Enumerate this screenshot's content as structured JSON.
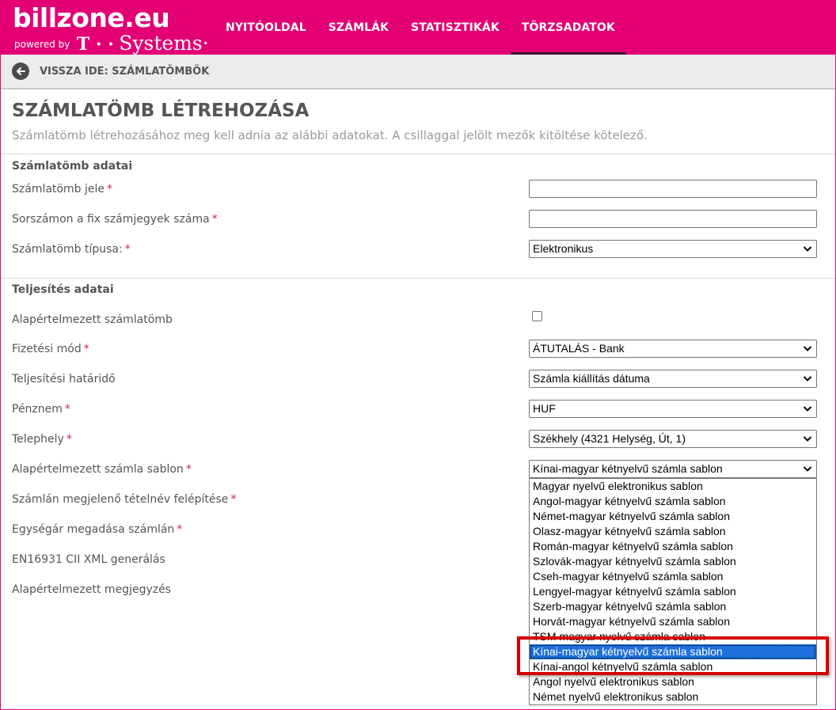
{
  "header": {
    "logo_main": "billzone.eu",
    "logo_powered": "powered by",
    "logo_tmark": "T · ·",
    "logo_systems": "Systems·",
    "nav": [
      {
        "label": "NYITÓOLDAL",
        "active": false
      },
      {
        "label": "SZÁMLÁK",
        "active": false
      },
      {
        "label": "STATISZTIKÁK",
        "active": false
      },
      {
        "label": "TÖRZSADATOK",
        "active": true
      }
    ],
    "brand_color": "#e20074"
  },
  "backbar": {
    "icon": "arrow-left-icon",
    "label": "VISSZA IDE: SZÁMLATÖMBÖK"
  },
  "page": {
    "title": "SZÁMLATÖMB LÉTREHOZÁSA",
    "subtitle": "Számlatömb létrehozásához meg kell adnia az alábbi adatokat. A csillaggal jelölt mezők kitöltése kötelező."
  },
  "sections": {
    "block": {
      "title": "Számlatömb adatai",
      "jel_label": "Számlatömb jele",
      "fix_label": "Sorszámon a fix számjegyek száma",
      "tipus_label": "Számlatömb típusa:",
      "tipus_value": "Elektronikus"
    },
    "teljesites": {
      "title": "Teljesítés adatai",
      "default_label": "Alapértelmezett számlatömb",
      "default_checked": false,
      "fizetesi_label": "Fizetési mód",
      "fizetesi_value": "ÁTUTALÁS - Bank",
      "hatarido_label": "Teljesítési határidő",
      "hatarido_value": "Számla kiállítás dátuma",
      "penznem_label": "Pénznem",
      "penznem_value": "HUF",
      "telephely_label": "Telephely",
      "telephely_value": "Székhely (4321 Helység, Út, 1)",
      "sablon_label": "Alapértelmezett számla sablon",
      "sablon_value": "Kínai-magyar kétnyelvű számla sablon",
      "tetelnev_label": "Számlán megjelenő tételnév felépítése",
      "egysegar_label": "Egységár megadása számlán",
      "xml_label": "EN16931 CII XML generálás",
      "megjegyzes_label": "Alapértelmezett megjegyzés"
    }
  },
  "required_mark": "*",
  "dropdown_options": [
    "Magyar nyelvű elektronikus sablon",
    "Angol-magyar kétnyelvű számla sablon",
    "Német-magyar kétnyelvű számla sablon",
    "Olasz-magyar kétnyelvű számla sablon",
    "Román-magyar kétnyelvű számla sablon",
    "Szlovák-magyar kétnyelvű számla sablon",
    "Cseh-magyar kétnyelvű számla sablon",
    "Lengyel-magyar kétnyelvű számla sablon",
    "Szerb-magyar kétnyelvű számla sablon",
    "Horvát-magyar kétnyelvű számla sablon",
    "TSM magyar nyelvű számla sablon",
    "Kínai-magyar kétnyelvű számla sablon",
    "Kínai-angol kétnyelvű számla sablon",
    "Angol nyelvű elektronikus sablon",
    "Német nyelvű elektronikus sablon"
  ],
  "selected_option_index": 11,
  "annotation_color": "#d40000"
}
